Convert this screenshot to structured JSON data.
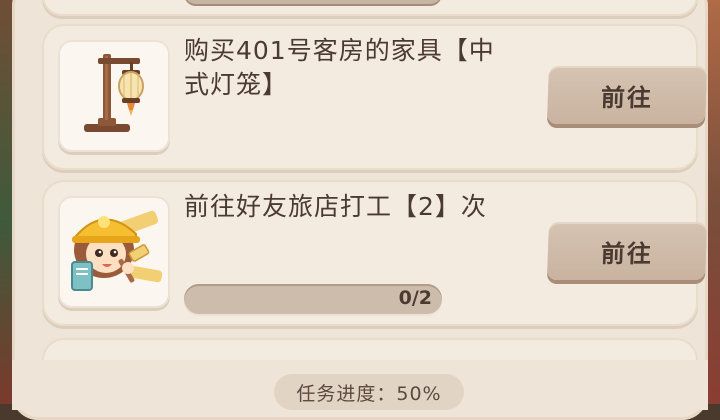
{
  "tasks": [
    {
      "title": "购买401号客房的家具【中式灯笼】",
      "button_label": "前往",
      "icon": "chinese-lantern-icon"
    },
    {
      "title": "前往好友旅店打工【2】次",
      "button_label": "前往",
      "icon": "construction-worker-icon",
      "progress_text": "0/2",
      "progress_fraction": 0
    }
  ],
  "footer": {
    "progress_label": "任务进度：50%"
  }
}
